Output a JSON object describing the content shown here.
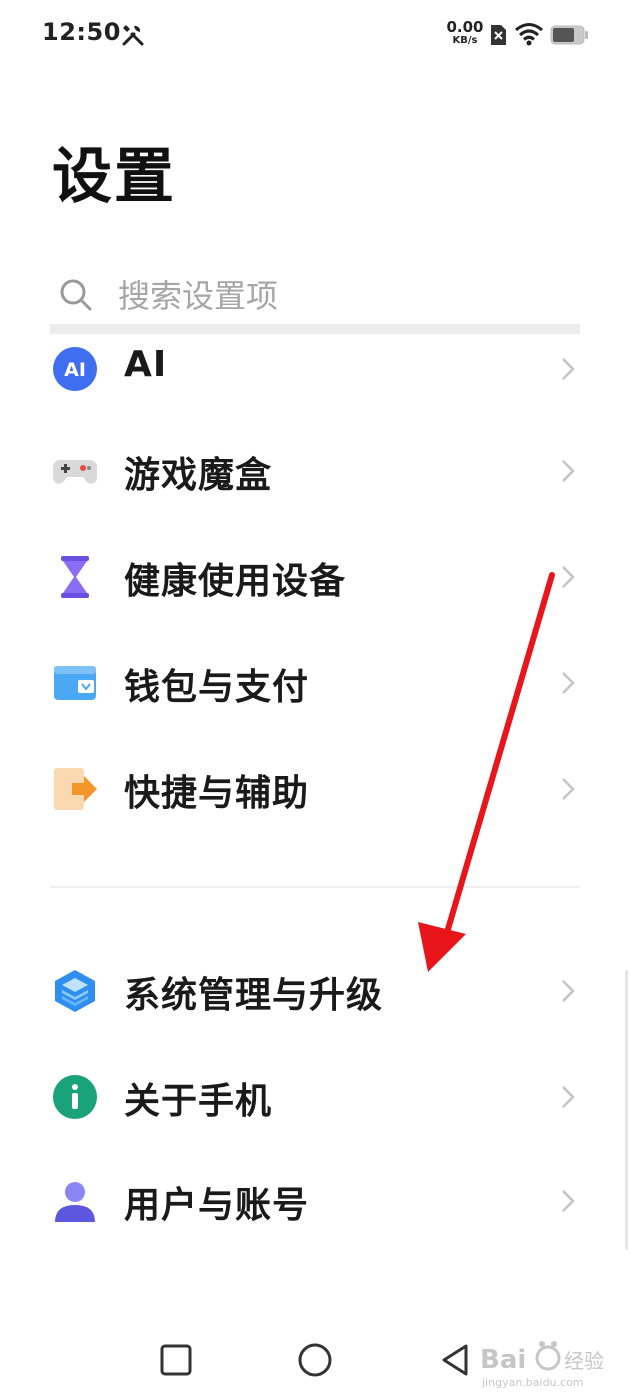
{
  "status_bar": {
    "time": "12:50",
    "net_speed_value": "0.00",
    "net_speed_unit": "KB/s",
    "icons": [
      "tools-icon",
      "sim-off-icon",
      "wifi-icon",
      "battery-icon"
    ]
  },
  "page_title": "设置",
  "search": {
    "placeholder": "搜索设置项",
    "value": ""
  },
  "menu": [
    {
      "label": "AI",
      "icon": "ai-icon",
      "icon_text": "AI",
      "color": "#3f6ff0"
    },
    {
      "label": "游戏魔盒",
      "icon": "gamepad-icon",
      "color": "#d8d8d8"
    },
    {
      "label": "健康使用设备",
      "icon": "hourglass-icon",
      "color": "#7b5cf0"
    },
    {
      "label": "钱包与支付",
      "icon": "wallet-icon",
      "color": "#3aa0f0"
    },
    {
      "label": "快捷与辅助",
      "icon": "shortcut-icon",
      "color": "#f5a23a"
    },
    {
      "label": "系统管理与升级",
      "icon": "layers-icon",
      "color": "#2f8ff0"
    },
    {
      "label": "关于手机",
      "icon": "info-icon",
      "color": "#1aa37a"
    },
    {
      "label": "用户与账号",
      "icon": "user-icon",
      "color": "#6b66e6"
    }
  ],
  "nav": [
    "recents-button",
    "home-button",
    "back-button"
  ],
  "colors": {
    "annotation_arrow": "#e8161b",
    "chevron": "#c4c4c4"
  }
}
